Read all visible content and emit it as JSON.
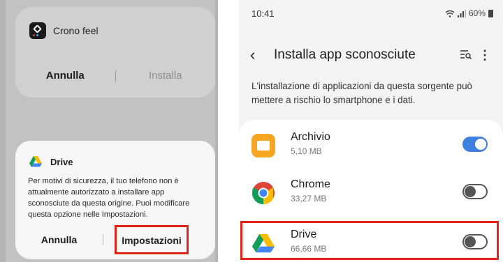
{
  "left": {
    "install_card": {
      "app_name": "Crono feel",
      "cancel_label": "Annulla",
      "install_label": "Installa"
    },
    "dialog": {
      "app_name": "Drive",
      "message": "Per motivi di sicurezza, il tuo telefono non è attualmente autorizzato a installare app sconosciute da questa origine. Puoi modificare questa opzione nelle Impostazioni.",
      "cancel_label": "Annulla",
      "settings_label": "Impostazioni"
    }
  },
  "right": {
    "status_bar": {
      "time": "10:41",
      "battery": "60%"
    },
    "header": {
      "title": "Installa app sconosciute",
      "back_icon": "back-chevron-icon",
      "search_icon": "search-list-icon",
      "more_icon": "more-vertical-icon"
    },
    "description": "L'installazione di applicazioni da questa sorgente può mettere a rischio lo smartphone e i dati.",
    "apps": [
      {
        "name": "Archivio",
        "size": "5,10 MB",
        "enabled": true,
        "icon": "folder-icon"
      },
      {
        "name": "Chrome",
        "size": "33,27 MB",
        "enabled": false,
        "icon": "chrome-icon"
      },
      {
        "name": "Drive",
        "size": "66,66 MB",
        "enabled": false,
        "icon": "drive-icon"
      }
    ]
  },
  "colors": {
    "accent": "#3f7fe0",
    "highlight": "#e2231a"
  }
}
